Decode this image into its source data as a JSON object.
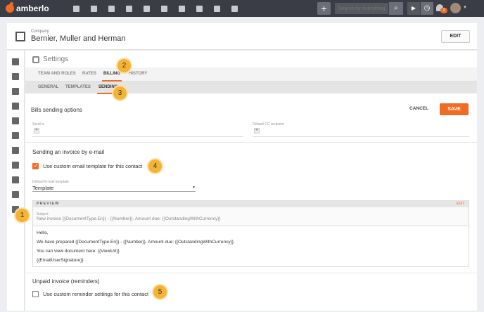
{
  "app": {
    "brand": "amberlo"
  },
  "topbar": {
    "search_placeholder": "Search for everything...",
    "notification_count": "2"
  },
  "company": {
    "label": "Company",
    "name": "Bernier, Muller and Herman",
    "edit_label": "EDIT"
  },
  "settings": {
    "title": "Settings"
  },
  "tabs": [
    {
      "label": "TEAM AND ROLES"
    },
    {
      "label": "RATES"
    },
    {
      "label": "BILLING"
    },
    {
      "label": "HISTORY"
    }
  ],
  "subtabs": [
    {
      "label": "GENERAL"
    },
    {
      "label": "TEMPLATES"
    },
    {
      "label": "SENDING"
    }
  ],
  "bills": {
    "title": "Bills sending options",
    "cancel_label": "CANCEL",
    "save_label": "SAVE",
    "send_to_label": "Send to",
    "cc_label": "Default CC recipient",
    "plus": "+"
  },
  "email_section": {
    "title": "Sending an invoice by e-mail",
    "custom_template_label": "Use custom email template for this contact",
    "template_field_label": "Default E-mail template",
    "template_value": "Template"
  },
  "preview": {
    "title": "PREVIEW",
    "edit_label": "EDIT",
    "subject_label": "Subject",
    "subject_value": "New invoice {{DocumentType.En}} - {{Number}}. Amount due: {{OutstandingWithCurrency}}",
    "body_lines": [
      "Hello,",
      "We have prepared {{DocumentType.En}} - {{Number}}. Amount due: {{OutstandingWithCurrency}}.",
      "You can view document here: {{ViewUrl}}",
      "{{EmailUserSignature}}"
    ]
  },
  "unpaid_section": {
    "title": "Unpaid invoice (reminders)",
    "custom_reminder_label": "Use custom reminder settings for this contact"
  },
  "badges": [
    "1",
    "2",
    "3",
    "4",
    "5"
  ],
  "colors": {
    "accent": "#f26b23",
    "badge": "#f5b335",
    "topbar": "#3a3d45"
  }
}
